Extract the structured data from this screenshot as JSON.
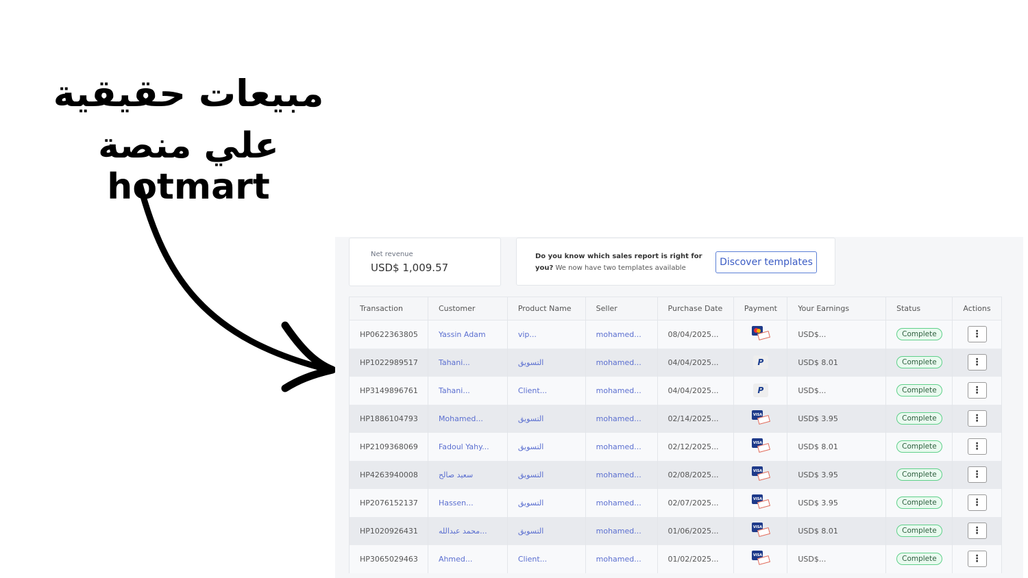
{
  "headline": {
    "line1": "مبيعات حقيقية",
    "line2": "علي منصة hotmart"
  },
  "summary": {
    "net_revenue_label": "Net revenue",
    "net_revenue_value": "USD$ 1,009.57"
  },
  "promo": {
    "question": "Do you know which sales report is right for you?",
    "text": "We now have two templates available",
    "button": "Discover templates"
  },
  "table": {
    "headers": [
      "Transaction",
      "Customer",
      "Product Name",
      "Seller",
      "Purchase Date",
      "Payment",
      "Your Earnings",
      "Status",
      "Actions"
    ],
    "rows": [
      {
        "id": "HP0622363805",
        "customer": "Yassin Adam",
        "product": "vip...",
        "seller": "mohamed...",
        "date": "08/04/2025...",
        "payment": "mastercard",
        "earnings": "USD$...",
        "status": "Complete"
      },
      {
        "id": "HP1022989517",
        "customer": "Tahani...",
        "product": "التسويق",
        "seller": "mohamed...",
        "date": "04/04/2025...",
        "payment": "paypal",
        "earnings": "USD$ 8.01",
        "status": "Complete"
      },
      {
        "id": "HP3149896761",
        "customer": "Tahani...",
        "product": "Client...",
        "seller": "mohamed...",
        "date": "04/04/2025...",
        "payment": "paypal",
        "earnings": "USD$...",
        "status": "Complete"
      },
      {
        "id": "HP1886104793",
        "customer": "Mohamed...",
        "product": "التسويق",
        "seller": "mohamed...",
        "date": "02/14/2025...",
        "payment": "visa",
        "earnings": "USD$ 3.95",
        "status": "Complete"
      },
      {
        "id": "HP2109368069",
        "customer": "Fadoul Yahy...",
        "product": "التسويق",
        "seller": "mohamed...",
        "date": "02/12/2025...",
        "payment": "visa",
        "earnings": "USD$ 8.01",
        "status": "Complete"
      },
      {
        "id": "HP4263940008",
        "customer": "سعيد صالح",
        "product": "التسويق",
        "seller": "mohamed...",
        "date": "02/08/2025...",
        "payment": "visa",
        "earnings": "USD$ 3.95",
        "status": "Complete"
      },
      {
        "id": "HP2076152137",
        "customer": "Hassen...",
        "product": "التسويق",
        "seller": "mohamed...",
        "date": "02/07/2025...",
        "payment": "visa",
        "earnings": "USD$ 3.95",
        "status": "Complete"
      },
      {
        "id": "HP1020926431",
        "customer": "محمد عبدالله...",
        "product": "التسويق",
        "seller": "mohamed...",
        "date": "01/06/2025...",
        "payment": "visa",
        "earnings": "USD$ 8.01",
        "status": "Complete"
      },
      {
        "id": "HP3065029463",
        "customer": "Ahmed...",
        "product": "Client...",
        "seller": "mohamed...",
        "date": "01/02/2025...",
        "payment": "visa",
        "earnings": "USD$...",
        "status": "Complete"
      }
    ]
  }
}
